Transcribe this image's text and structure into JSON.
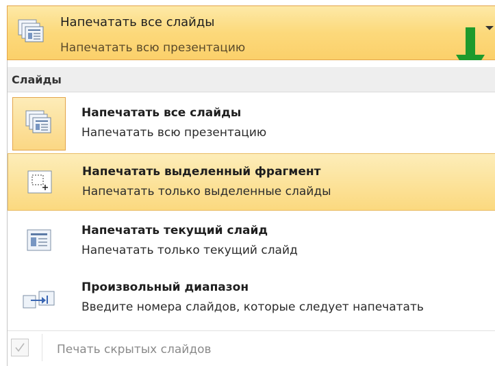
{
  "selector": {
    "title": "Напечатать все слайды",
    "subtitle": "Напечатать всю презентацию",
    "icon": "slides-stack-icon"
  },
  "annotation": {
    "icon": "green-arrow-down-icon",
    "color": "#1e9a2c"
  },
  "panel": {
    "section_label": "Слайды",
    "items": [
      {
        "title": "Напечатать все слайды",
        "subtitle": "Напечатать всю презентацию",
        "icon": "slides-stack-icon",
        "state": "selected"
      },
      {
        "title": "Напечатать выделенный фрагмент",
        "subtitle": "Напечатать только выделенные слайды",
        "icon": "selection-icon",
        "state": "hover"
      },
      {
        "title": "Напечатать текущий слайд",
        "subtitle": "Напечатать только текущий слайд",
        "icon": "current-slide-icon",
        "state": "normal"
      },
      {
        "title": "Произвольный диапазон",
        "subtitle": "Введите номера слайдов, которые следует напечатать",
        "icon": "slide-range-icon",
        "state": "normal"
      }
    ],
    "hidden_slides": {
      "label": "Печать скрытых слайдов",
      "checked": true,
      "enabled": false
    }
  },
  "colors": {
    "highlight": "#fbd97f",
    "highlight_border": "#e3a44a",
    "arrow": "#1e9a2c"
  }
}
